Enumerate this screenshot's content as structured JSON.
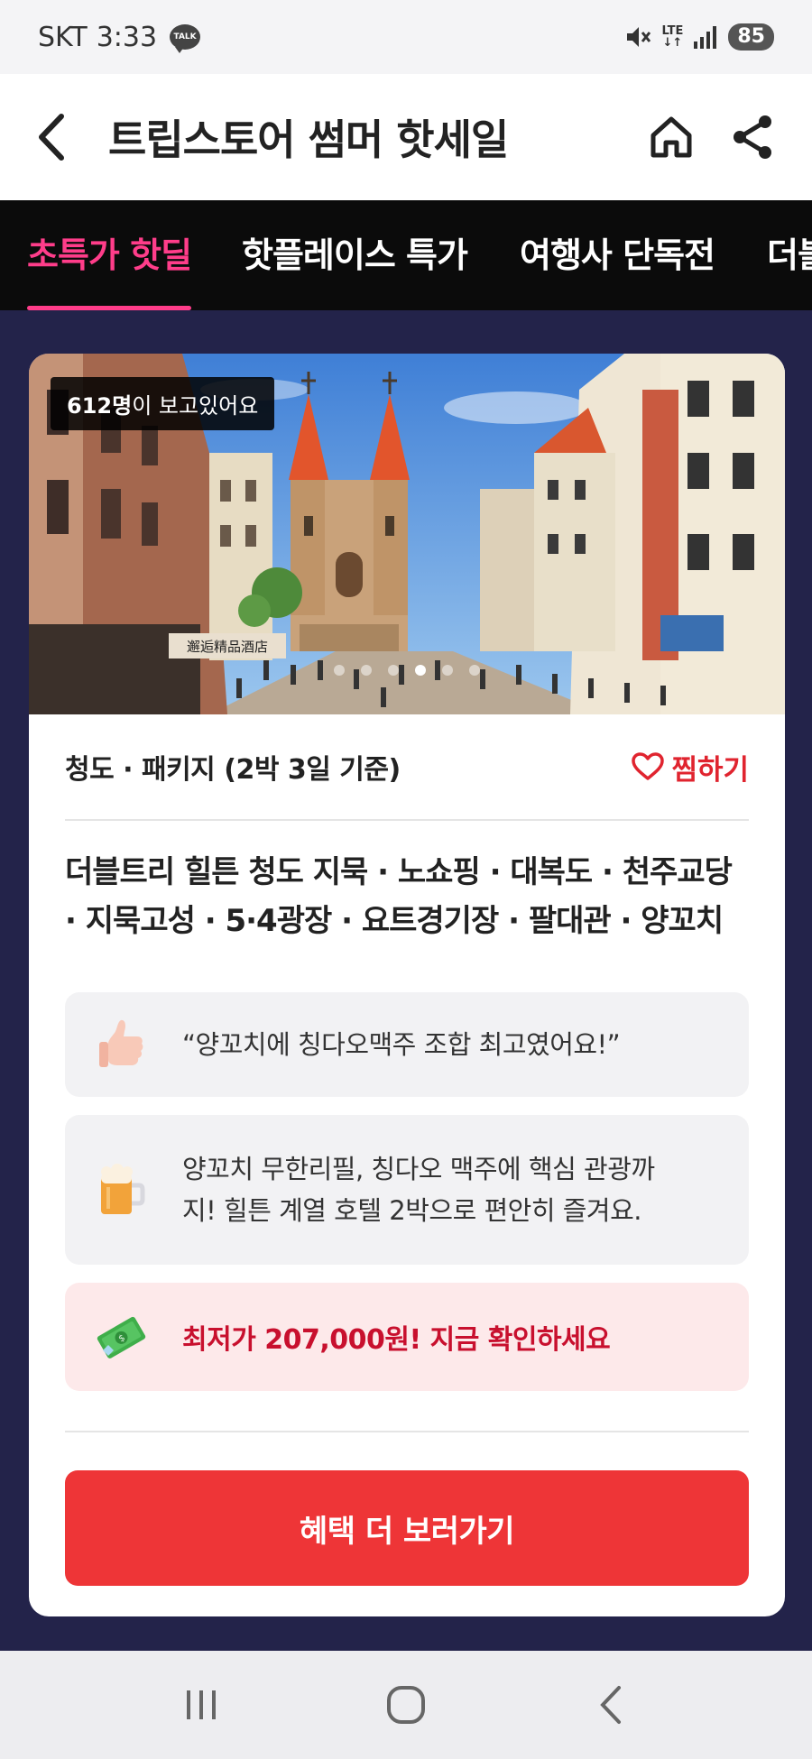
{
  "status": {
    "carrier": "SKT",
    "time": "3:33",
    "talk_badge": "TALK",
    "network": "LTE",
    "battery": "85"
  },
  "header": {
    "title": "트립스토어 썸머 핫세일"
  },
  "tabs": [
    {
      "label": "초특가 핫딜",
      "active": true
    },
    {
      "label": "핫플레이스 특가",
      "active": false
    },
    {
      "label": "여행사 단독전",
      "active": false
    },
    {
      "label": "더블",
      "active": false
    }
  ],
  "hero": {
    "viewers_count": "612명",
    "viewers_suffix": "이 보고있어요",
    "sign_text": "邂逅精品酒店",
    "slide_count": 6,
    "active_slide": 4
  },
  "deal": {
    "package_info": "청도 · 패키지 (2박 3일 기준)",
    "wish_label": "찜하기",
    "course_line1": "더블트리 힐튼 청도 지묵 · 노쇼핑 · 대복도 · 천주교당",
    "course_line2": "· 지묵고성 · 5·4광장 · 요트경기장 · 팔대관 · 양꼬치",
    "review_quote": "“양꼬치에 칭다오맥주 조합 최고였어요!”",
    "description_line1": "양꼬치 무한리필, 칭다오 맥주에 핵심 관광까",
    "description_line2": "지! 힐튼 계열 호텔 2박으로 편안히 즐겨요.",
    "price_text": "최저가 207,000원! 지금 확인하세요",
    "cta_label": "혜택 더 보러가기"
  },
  "icons": {
    "review": "thumbs-up-icon",
    "description": "beer-mug-icon",
    "price": "money-icon"
  },
  "colors": {
    "accent_pink": "#ff3d8a",
    "cta_red": "#ee3537",
    "price_red": "#c8102e",
    "page_bg": "#23234a"
  }
}
